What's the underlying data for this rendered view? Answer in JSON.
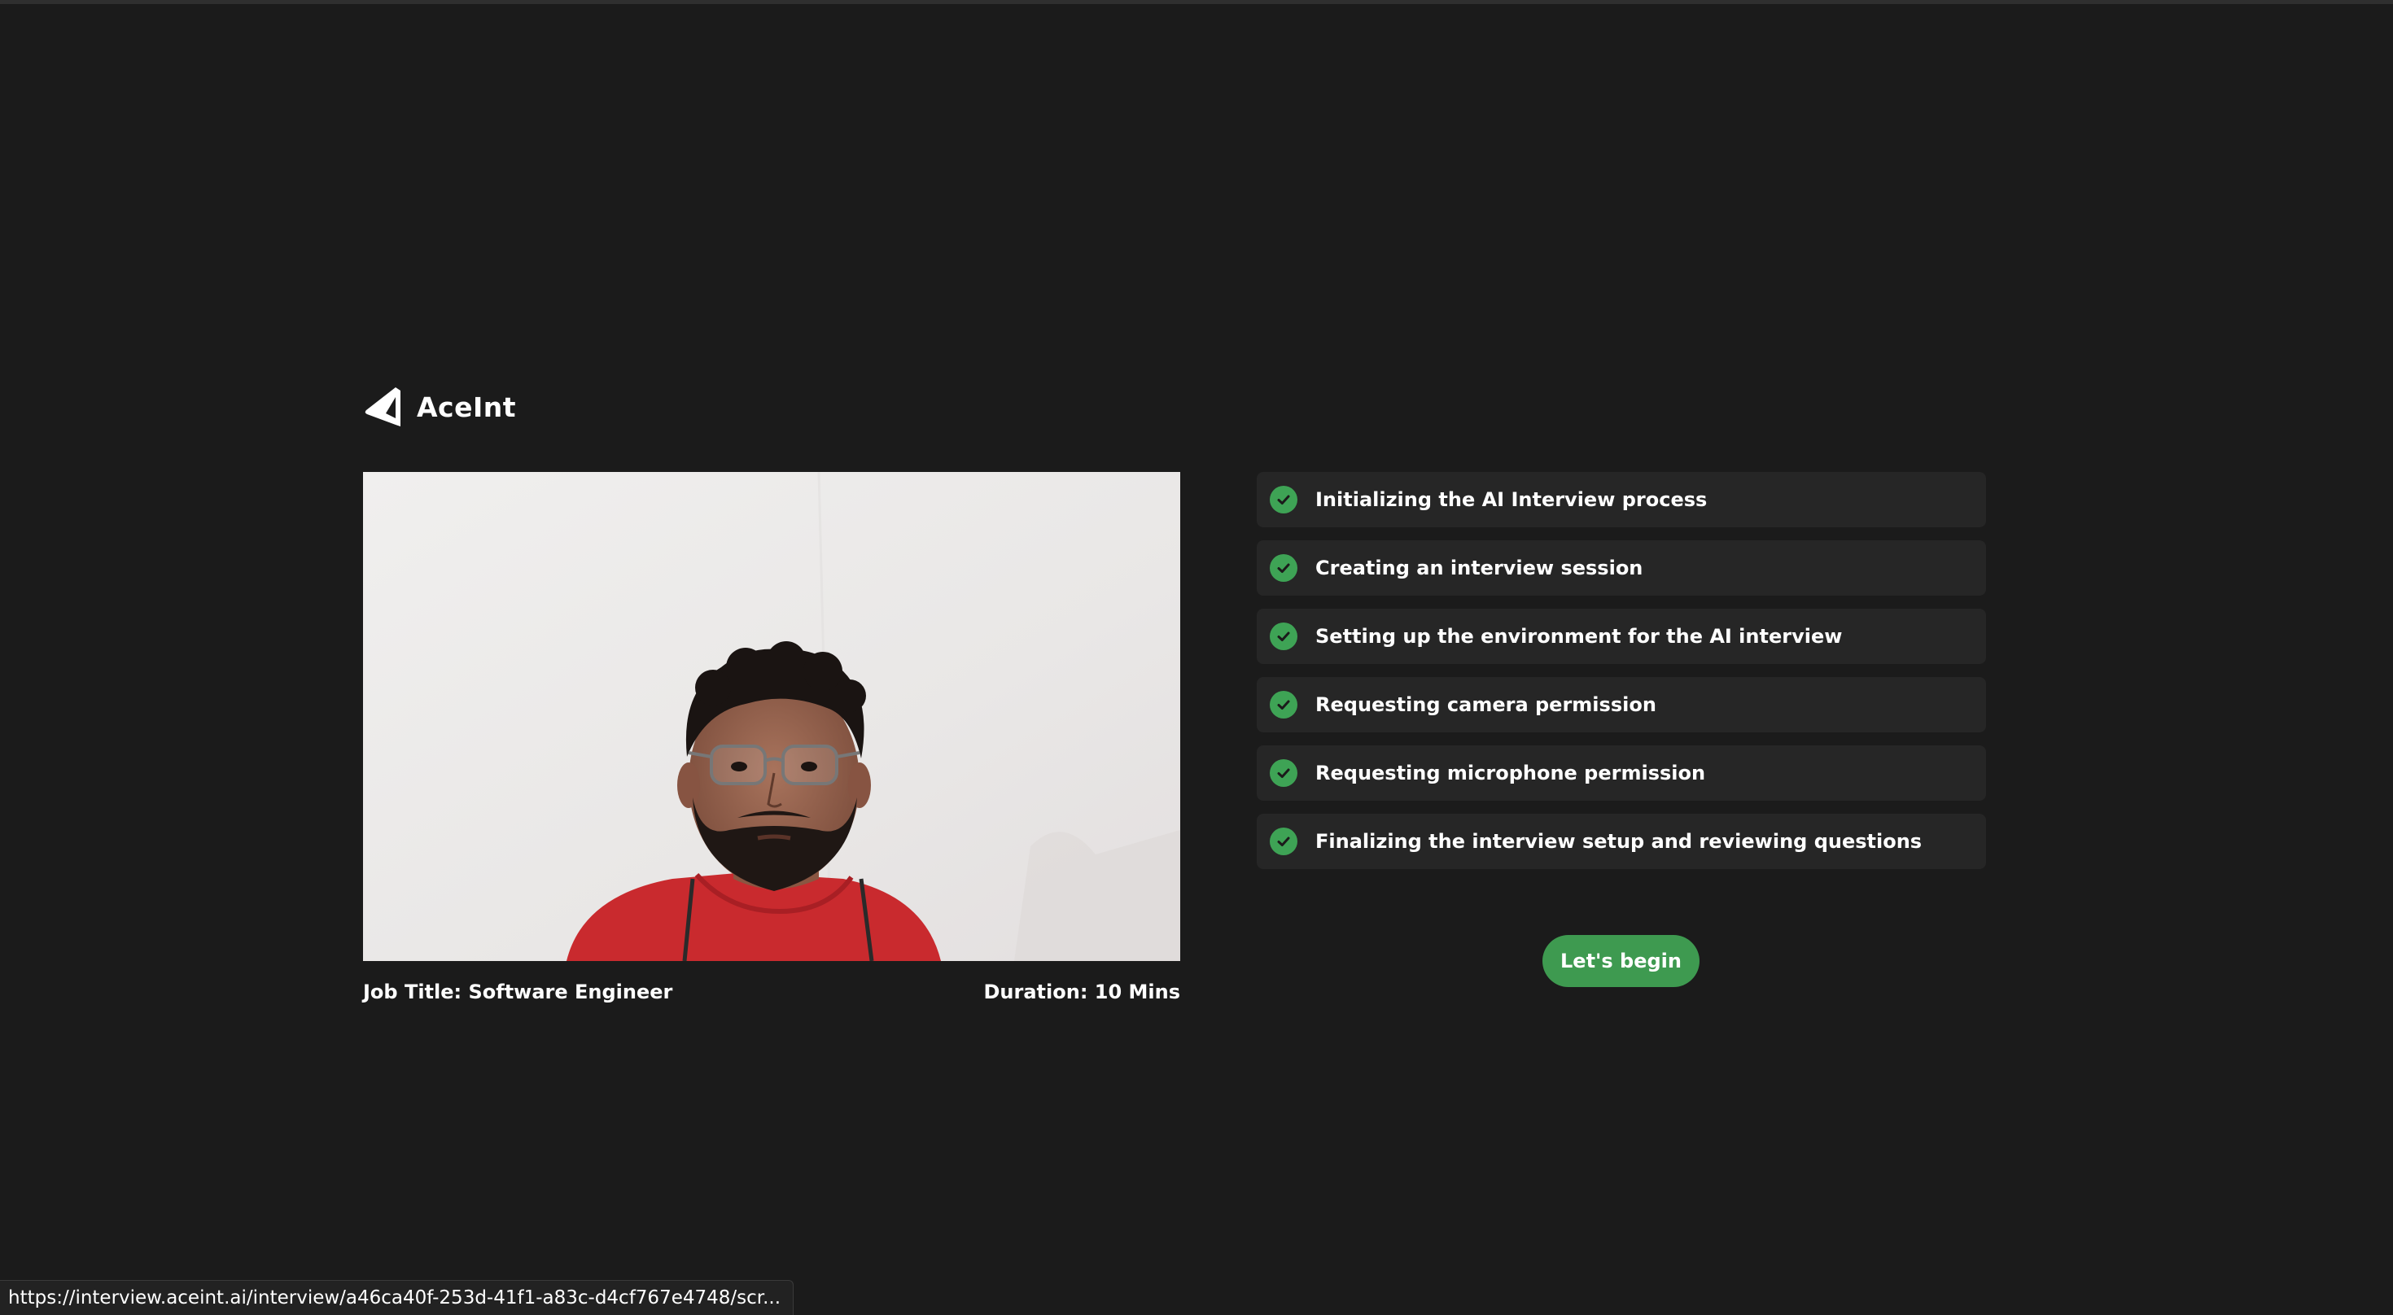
{
  "app": {
    "brand_name": "AceInt",
    "logo_icon": "aceint-logo-icon"
  },
  "interview": {
    "job_title_text": "Job Title: Software Engineer",
    "duration_text": "Duration: 10 Mins"
  },
  "setup_steps": [
    {
      "label": "Initializing the AI Interview process",
      "status": "done",
      "icon": "check-circle-icon"
    },
    {
      "label": "Creating an interview session",
      "status": "done",
      "icon": "check-circle-icon"
    },
    {
      "label": "Setting up the environment for the AI interview",
      "status": "done",
      "icon": "check-circle-icon"
    },
    {
      "label": "Requesting camera permission",
      "status": "done",
      "icon": "check-circle-icon"
    },
    {
      "label": "Requesting microphone permission",
      "status": "done",
      "icon": "check-circle-icon"
    },
    {
      "label": "Finalizing the interview setup and reviewing questions",
      "status": "done",
      "icon": "check-circle-icon"
    }
  ],
  "actions": {
    "begin_label": "Let's begin"
  },
  "status_bar": {
    "url": "https://interview.aceint.ai/interview/a46ca40f-253d-41f1-a83c-d4cf767e4748/scr..."
  },
  "colors": {
    "background": "#1b1b1b",
    "card": "#262626",
    "accent_green": "#3e9a50",
    "check_green": "#3ea355",
    "text": "#ffffff"
  }
}
